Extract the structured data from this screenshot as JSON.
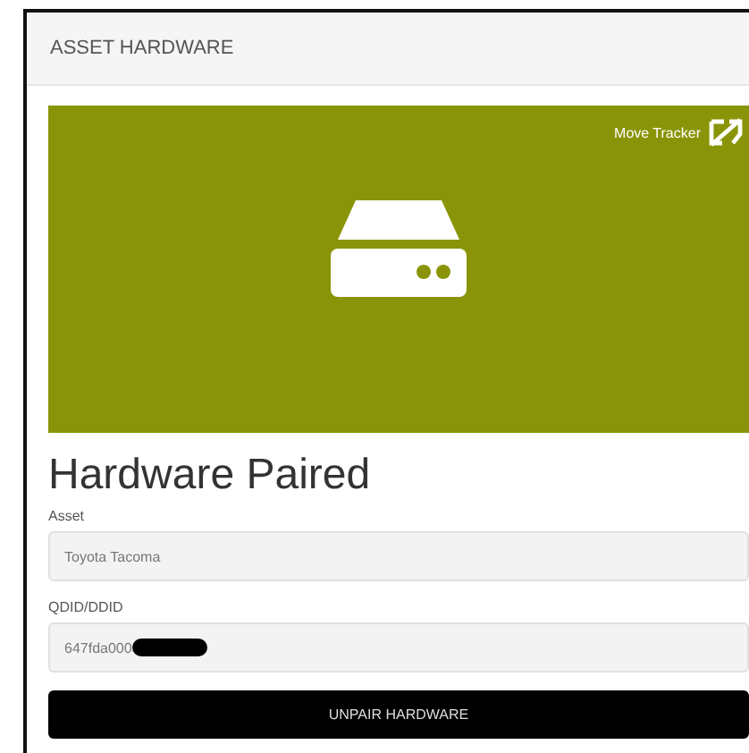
{
  "panel": {
    "title": "ASSET HARDWARE"
  },
  "banner": {
    "link": "Move Tracker"
  },
  "status": {
    "heading": "Hardware Paired"
  },
  "fields": [
    {
      "label": "Asset",
      "value": "Toyota Tacoma",
      "redacted": false
    },
    {
      "label": "QDID/DDID",
      "value": "647fda000",
      "redacted": true
    }
  ],
  "buttons": [
    {
      "label": "UNPAIR HARDWARE"
    }
  ]
}
